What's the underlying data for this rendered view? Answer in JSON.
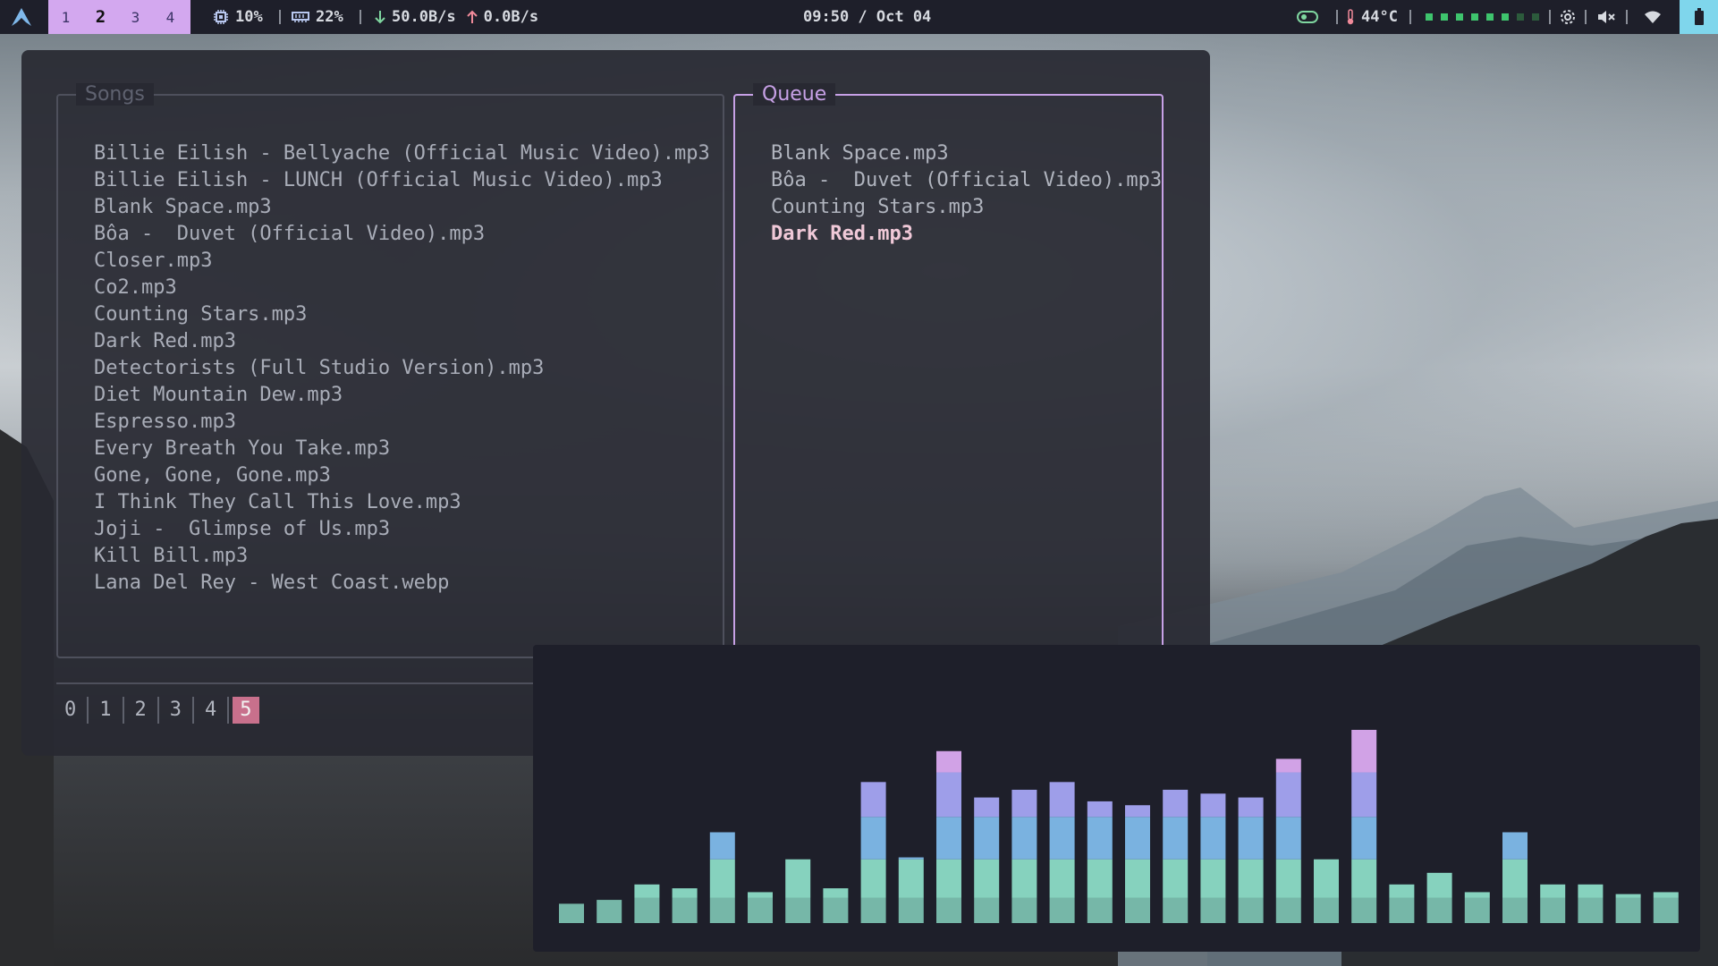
{
  "topbar": {
    "workspaces": [
      {
        "label": "1",
        "active": false
      },
      {
        "label": "2",
        "active": true
      },
      {
        "label": "3",
        "active": false
      },
      {
        "label": "4",
        "active": false
      }
    ],
    "cpu": "10%",
    "memory": "22%",
    "net_down": "50.0B/s",
    "net_up": "0.0B/s",
    "clock": "09:50 / Oct 04",
    "temperature": "44°C",
    "activity_dots": 8,
    "activity_active": 6
  },
  "music": {
    "songs_title": "Songs",
    "songs": [
      "Billie Eilish - Bellyache (Official Music Video).mp3",
      "Billie Eilish - LUNCH (Official Music Video).mp3",
      "Blank Space.mp3",
      "Bôa -  Duvet (Official Video).mp3",
      "Closer.mp3",
      "Co2.mp3",
      "Counting Stars.mp3",
      "Dark Red.mp3",
      "Detectorists (Full Studio Version).mp3",
      "Diet Mountain Dew.mp3",
      "Espresso.mp3",
      "Every Breath You Take.mp3",
      "Gone, Gone, Gone.mp3",
      "I Think They Call This Love.mp3",
      "Joji -  Glimpse of Us.mp3",
      "Kill Bill.mp3",
      "Lana Del Rey - West Coast.webp"
    ],
    "queue_title": "Queue",
    "queue": [
      "Blank Space.mp3",
      "Bôa -  Duvet (Official Video).mp3",
      "Counting Stars.mp3",
      "Dark Red.mp3"
    ],
    "queue_current_index": 3,
    "tabs": [
      "0",
      "1",
      "2",
      "3",
      "4",
      "5"
    ],
    "active_tab": "5"
  },
  "visualizer": {
    "levels": [
      0.1,
      0.12,
      0.2,
      0.18,
      0.47,
      0.16,
      0.33,
      0.18,
      0.73,
      0.34,
      0.89,
      0.65,
      0.69,
      0.73,
      0.63,
      0.61,
      0.69,
      0.67,
      0.65,
      0.85,
      0.33,
      1.0,
      0.2,
      0.26,
      0.16,
      0.47,
      0.2,
      0.2,
      0.15,
      0.16
    ],
    "colors": {
      "low": "#86d2be",
      "mid": "#7ab2e0",
      "high": "#9e9ee9",
      "top": "#d1a2e6"
    }
  }
}
